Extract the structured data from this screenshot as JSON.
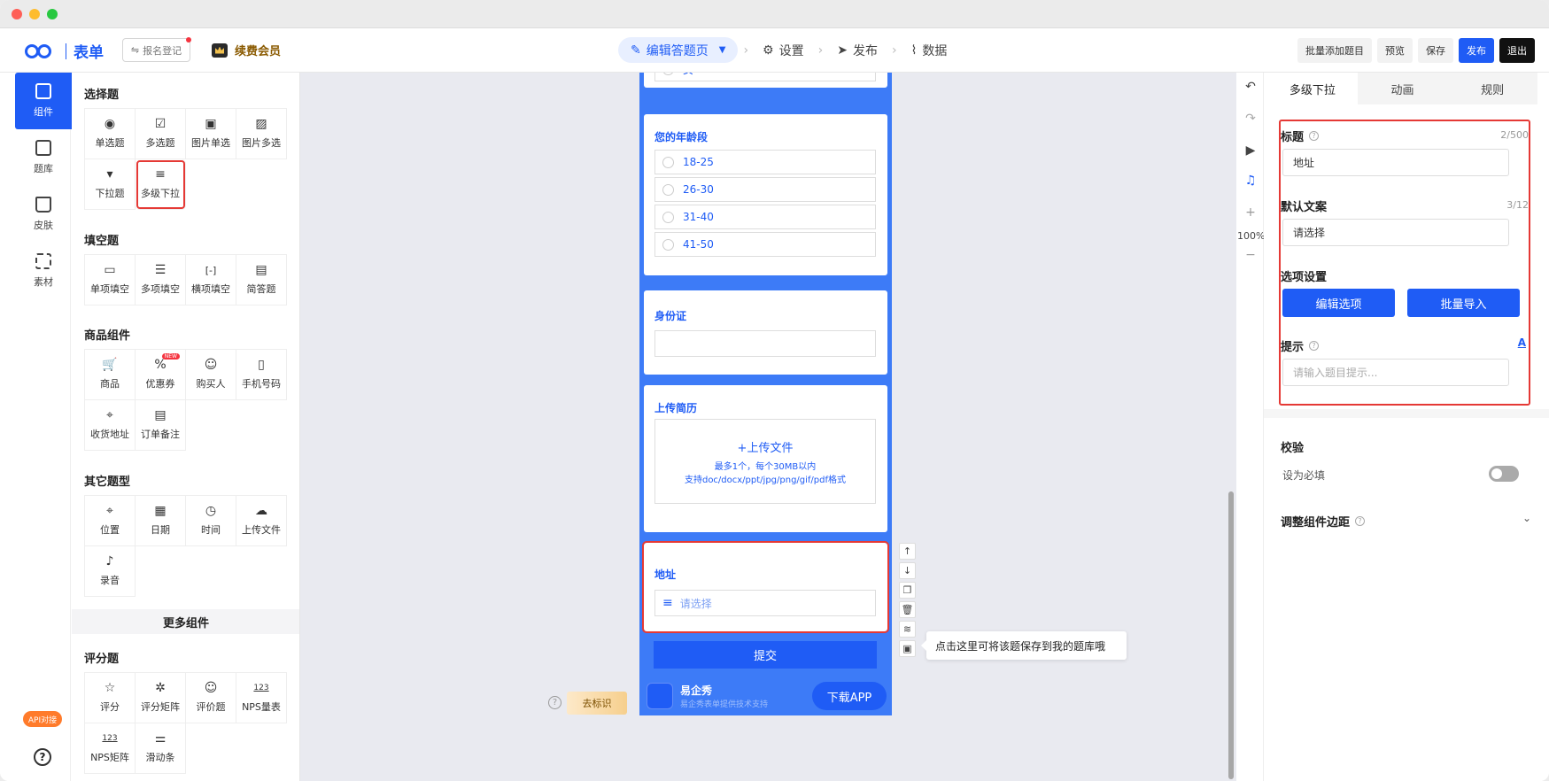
{
  "colors": {
    "accent": "#1f5cf5",
    "highlight": "#e53935",
    "phone_bg": "#3d7bf7"
  },
  "brand": {
    "name": "表单"
  },
  "header": {
    "form_name": "报名登记",
    "vip_label": "续费会员",
    "steps": [
      {
        "label": "编辑答题页",
        "icon": "edit-icon"
      },
      {
        "label": "设置",
        "icon": "gear-icon"
      },
      {
        "label": "发布",
        "icon": "send-icon"
      },
      {
        "label": "数据",
        "icon": "chart-icon"
      }
    ],
    "buttons": {
      "batch_add": "批量添加题目",
      "preview": "预览",
      "save": "保存",
      "publish": "发布",
      "exit": "退出"
    }
  },
  "leftnav": {
    "items": [
      {
        "label": "组件",
        "icon": "component-icon"
      },
      {
        "label": "题库",
        "icon": "library-icon"
      },
      {
        "label": "皮肤",
        "icon": "shirt-icon"
      },
      {
        "label": "素材",
        "icon": "material-icon"
      }
    ],
    "api_badge": "API对接",
    "help": "?"
  },
  "components": {
    "choice_title": "选择题",
    "choice": [
      {
        "label": "单选题",
        "glyph": "◉"
      },
      {
        "label": "多选题",
        "glyph": "☑"
      },
      {
        "label": "图片单选",
        "glyph": "▣"
      },
      {
        "label": "图片多选",
        "glyph": "▨"
      },
      {
        "label": "下拉题",
        "glyph": "▾"
      },
      {
        "label": "多级下拉",
        "glyph": "≡"
      }
    ],
    "fill_title": "填空题",
    "fill": [
      {
        "label": "单项填空",
        "glyph": "▭"
      },
      {
        "label": "多项填空",
        "glyph": "☰"
      },
      {
        "label": "横项填空",
        "glyph": "[-]"
      },
      {
        "label": "简答题",
        "glyph": "▤"
      }
    ],
    "goods_title": "商品组件",
    "goods": [
      {
        "label": "商品",
        "glyph": "🛒"
      },
      {
        "label": "优惠券",
        "glyph": "%"
      },
      {
        "label": "购买人",
        "glyph": "☺"
      },
      {
        "label": "手机号码",
        "glyph": "▯"
      },
      {
        "label": "收货地址",
        "glyph": "⌖"
      },
      {
        "label": "订单备注",
        "glyph": "▤"
      }
    ],
    "new_badge": "NEW",
    "other_title": "其它题型",
    "other": [
      {
        "label": "位置",
        "glyph": "⌖"
      },
      {
        "label": "日期",
        "glyph": "▦"
      },
      {
        "label": "时间",
        "glyph": "◷"
      },
      {
        "label": "上传文件",
        "glyph": "☁"
      },
      {
        "label": "录音",
        "glyph": "♪"
      }
    ],
    "more": "更多组件",
    "rating_title": "评分题",
    "rating": [
      {
        "label": "评分",
        "glyph": "☆"
      },
      {
        "label": "评分矩阵",
        "glyph": "✲"
      },
      {
        "label": "评价题",
        "glyph": "☺"
      },
      {
        "label": "NPS量表",
        "glyph": "123"
      },
      {
        "label": "NPS矩阵",
        "glyph": "123"
      },
      {
        "label": "滑动条",
        "glyph": "⚌"
      }
    ]
  },
  "form": {
    "partial_option": "女",
    "age": {
      "title": "您的年龄段",
      "options": [
        "18-25",
        "26-30",
        "31-40",
        "41-50"
      ]
    },
    "id_card": {
      "title": "身份证"
    },
    "resume": {
      "title": "上传简历",
      "upload_label": "+上传文件",
      "hint1": "最多1个，每个30MB以内",
      "hint2": "支持doc/docx/ppt/jpg/png/gif/pdf格式"
    },
    "address": {
      "title": "地址",
      "placeholder": "请选择"
    },
    "submit": "提交",
    "footer": {
      "brand": "易企秀",
      "sub": "易企秀表单提供技术支持",
      "download": "下载APP"
    }
  },
  "canvas": {
    "mark_label": "去标识",
    "tip": "点击这里可将该题保存到我的题库哦",
    "zoom": "100%"
  },
  "props": {
    "tabs": [
      "多级下拉",
      "动画",
      "规则"
    ],
    "title_label": "标题",
    "title_count": "2/500",
    "title_value": "地址",
    "default_label": "默认文案",
    "default_count": "3/12",
    "default_value": "请选择",
    "options_label": "选项设置",
    "edit_options": "编辑选项",
    "batch_import": "批量导入",
    "hint_label": "提示",
    "hint_placeholder": "请输入题目提示...",
    "validate_label": "校验",
    "required_label": "设为必填",
    "required_on": false,
    "margin_label": "调整组件边距"
  }
}
